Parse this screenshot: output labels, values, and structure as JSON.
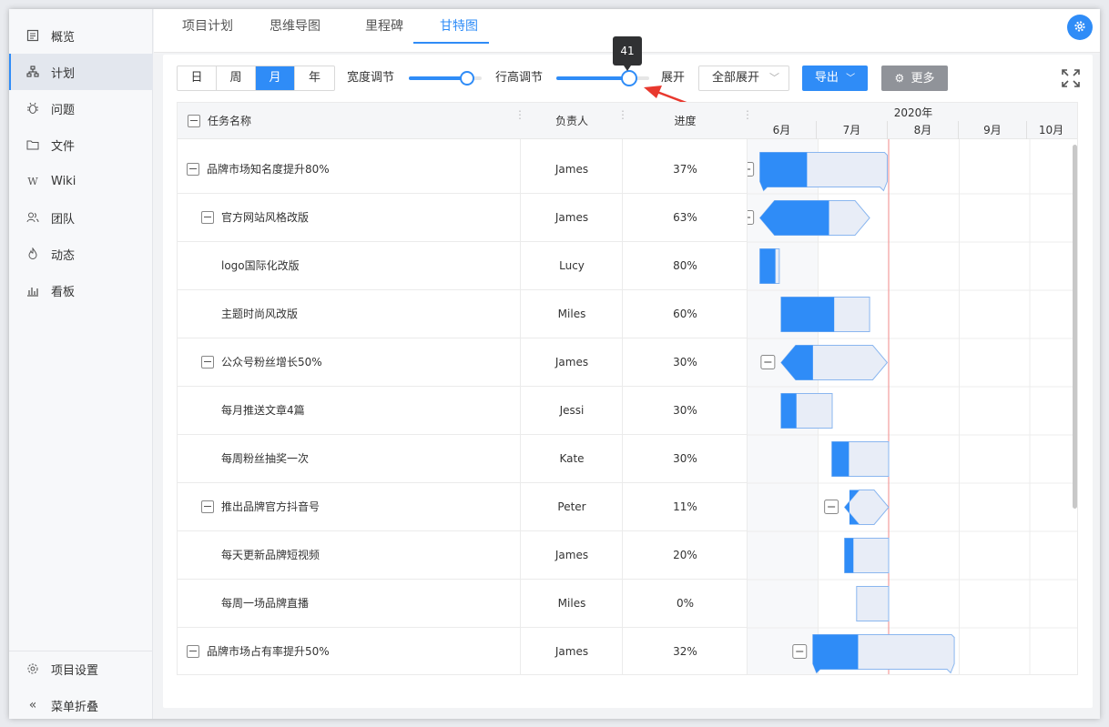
{
  "sidebar": {
    "items": [
      {
        "label": "概览",
        "icon": "overview-icon"
      },
      {
        "label": "计划",
        "icon": "plan-icon"
      },
      {
        "label": "问题",
        "icon": "bug-icon"
      },
      {
        "label": "文件",
        "icon": "folder-icon"
      },
      {
        "label": "Wiki",
        "icon": "wiki-icon"
      },
      {
        "label": "团队",
        "icon": "team-icon"
      },
      {
        "label": "动态",
        "icon": "activity-icon"
      },
      {
        "label": "看板",
        "icon": "board-icon"
      }
    ],
    "active_index": 1,
    "settings_label": "项目设置",
    "collapse_label": "菜单折叠"
  },
  "tabs": [
    "项目计划",
    "思维导图",
    "里程碑",
    "甘特图"
  ],
  "active_tab": 3,
  "toolbar": {
    "scale_options": [
      "日",
      "周",
      "月",
      "年"
    ],
    "scale_selected": "月",
    "width_label": "宽度调节",
    "width_value": 0.8,
    "row_height_label": "行高调节",
    "row_height_tooltip": "41",
    "row_height_value": 0.78,
    "expand_label": "展开",
    "expand_select": "全部展开",
    "export_label": "导出",
    "more_label": "更多"
  },
  "table": {
    "headers": {
      "name": "任务名称",
      "owner": "负责人",
      "progress": "进度"
    },
    "timeline_year": "2020年",
    "timeline_months": [
      "6月",
      "7月",
      "8月",
      "9月",
      "10月"
    ],
    "rows": [
      {
        "name": "品牌市场知名度提升80%",
        "owner": "James",
        "progress": "37%",
        "level": 0,
        "type": "summary",
        "start": 0.15,
        "end": 1.98,
        "pct": 0.37
      },
      {
        "name": "官方网站风格改版",
        "owner": "James",
        "progress": "63%",
        "level": 1,
        "type": "group",
        "start": 0.15,
        "end": 1.73,
        "pct": 0.63
      },
      {
        "name": "logo国际化改版",
        "owner": "Lucy",
        "progress": "80%",
        "level": 2,
        "type": "task",
        "start": 0.15,
        "end": 0.45,
        "pct": 0.8
      },
      {
        "name": "主题时尚风改版",
        "owner": "Miles",
        "progress": "60%",
        "level": 2,
        "type": "task",
        "start": 0.45,
        "end": 1.73,
        "pct": 0.6
      },
      {
        "name": "公众号粉丝增长50%",
        "owner": "James",
        "progress": "30%",
        "level": 1,
        "type": "group",
        "start": 0.45,
        "end": 1.98,
        "pct": 0.3
      },
      {
        "name": "每月推送文章4篇",
        "owner": "Jessi",
        "progress": "30%",
        "level": 2,
        "type": "task",
        "start": 0.45,
        "end": 1.2,
        "pct": 0.3
      },
      {
        "name": "每周粉丝抽奖一次",
        "owner": "Kate",
        "progress": "30%",
        "level": 2,
        "type": "task",
        "start": 1.17,
        "end": 2.0,
        "pct": 0.3
      },
      {
        "name": "推出品牌官方抖音号",
        "owner": "Peter",
        "progress": "11%",
        "level": 1,
        "type": "group",
        "start": 1.35,
        "end": 2.0,
        "pct": 0.11
      },
      {
        "name": "每天更新品牌短视频",
        "owner": "James",
        "progress": "20%",
        "level": 2,
        "type": "task",
        "start": 1.35,
        "end": 2.0,
        "pct": 0.2
      },
      {
        "name": "每周一场品牌直播",
        "owner": "Miles",
        "progress": "0%",
        "level": 2,
        "type": "task",
        "start": 1.52,
        "end": 2.0,
        "pct": 0.0
      },
      {
        "name": "品牌市场占有率提升50%",
        "owner": "James",
        "progress": "32%",
        "level": 0,
        "type": "summary",
        "start": 0.9,
        "end": 2.93,
        "pct": 0.32
      }
    ]
  },
  "colors": {
    "accent": "#2f8cf7",
    "bar_bg": "#e8edf7",
    "today_line": "#f08a8a"
  }
}
